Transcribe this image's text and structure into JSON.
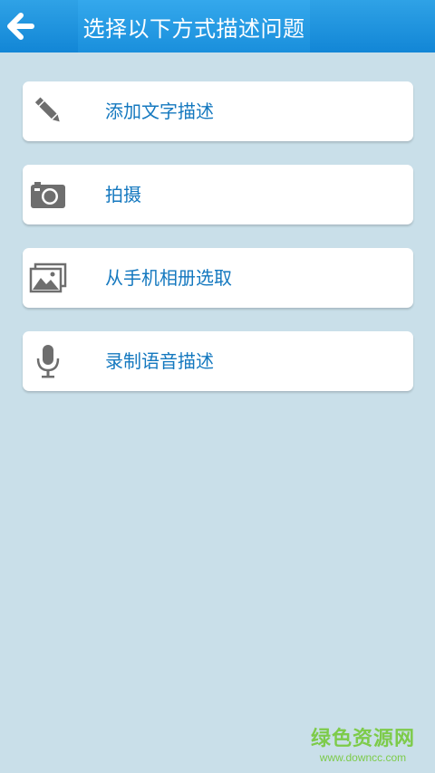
{
  "header": {
    "title": "选择以下方式描述问题",
    "back_icon": "arrow-left-icon"
  },
  "options": [
    {
      "icon": "pencil-icon",
      "label": "添加文字描述"
    },
    {
      "icon": "camera-icon",
      "label": "拍摄"
    },
    {
      "icon": "gallery-icon",
      "label": "从手机相册选取"
    },
    {
      "icon": "microphone-icon",
      "label": "录制语音描述"
    }
  ],
  "watermark": {
    "name": "绿色资源网",
    "url": "www.downcc.com"
  },
  "colors": {
    "header": "#1a8fdc",
    "background": "#c9dfe9",
    "label": "#1478bf",
    "icon": "#6e6e6e"
  }
}
